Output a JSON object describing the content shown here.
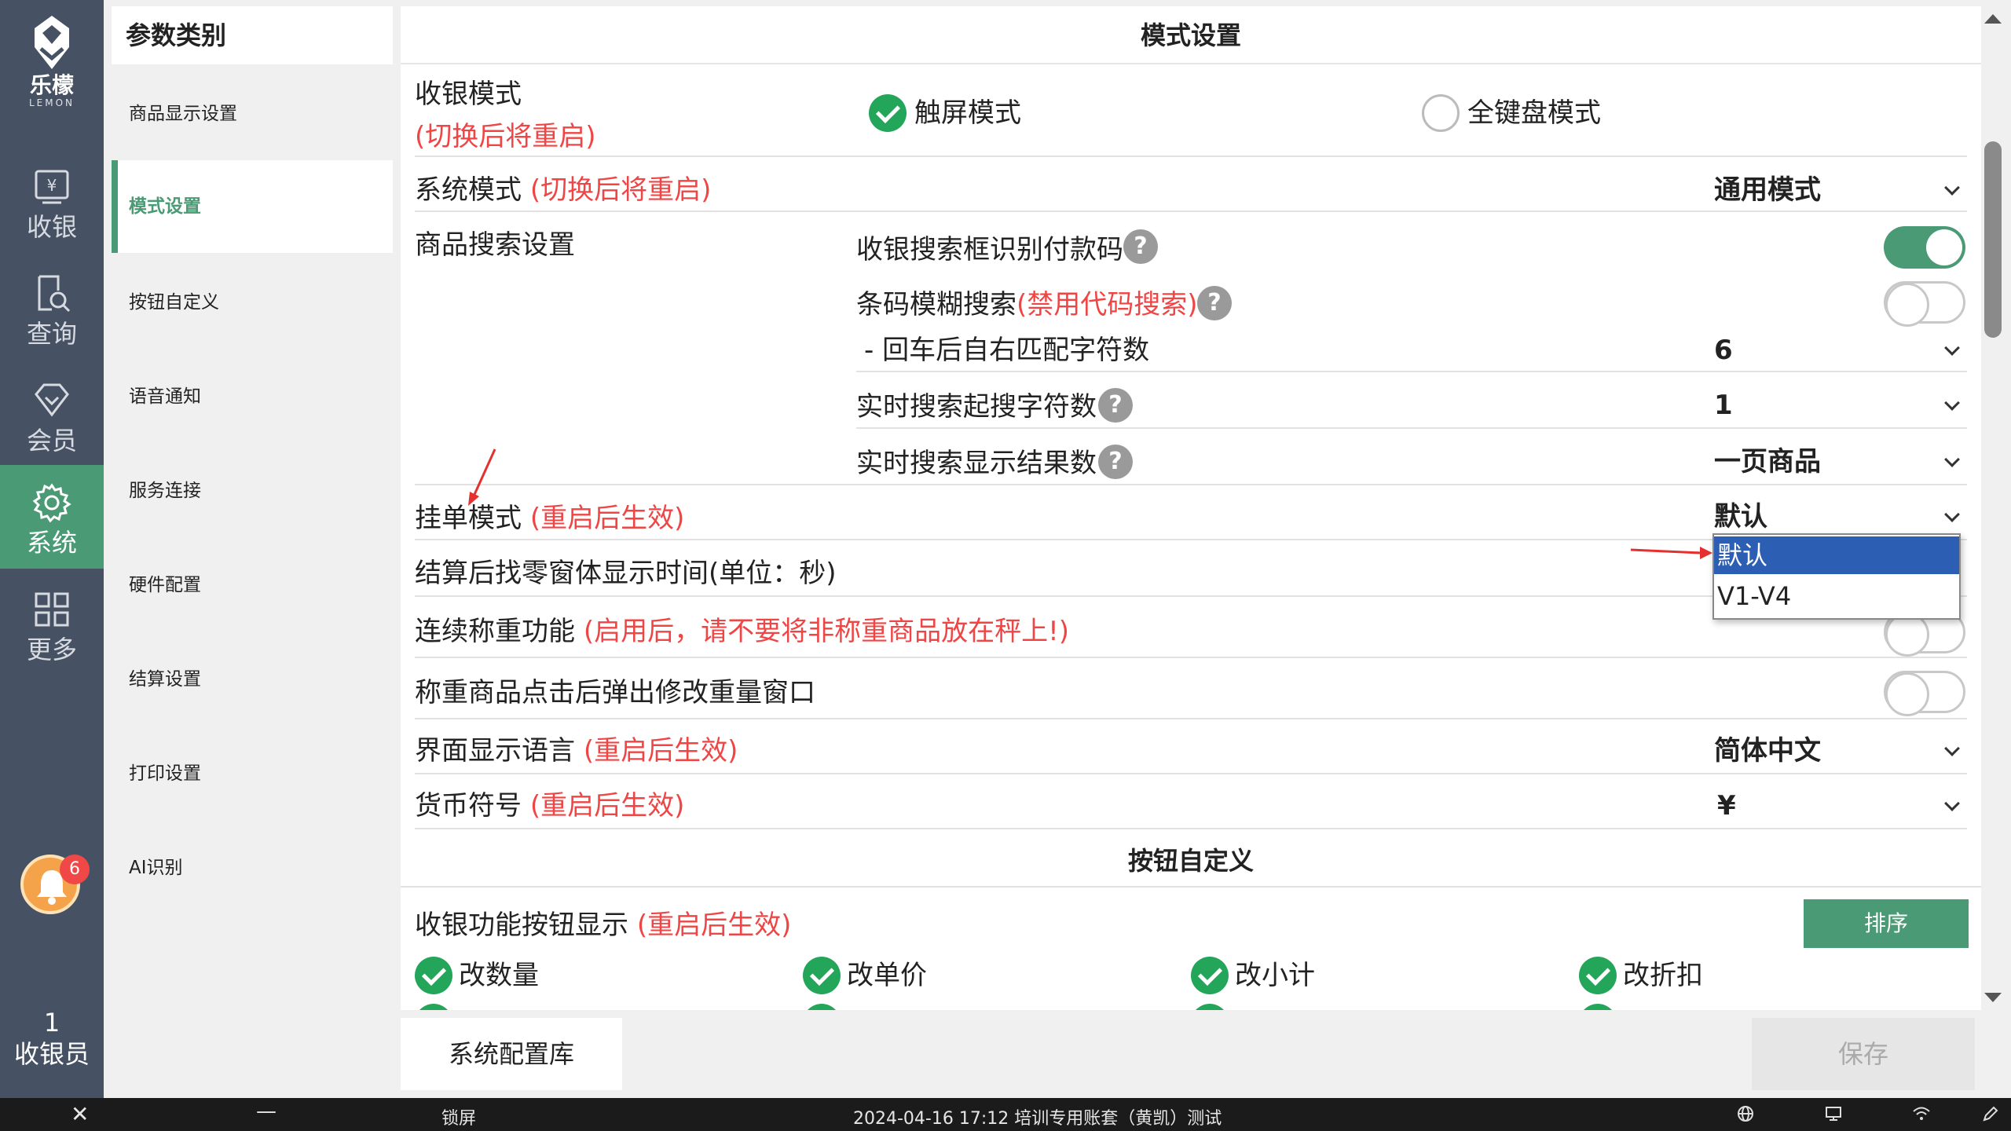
{
  "brand": {
    "name_cn": "乐檬",
    "name_en": "LEMON"
  },
  "rail": {
    "items": [
      {
        "label": "收银",
        "icon": "cash-register-icon"
      },
      {
        "label": "查询",
        "icon": "search-doc-icon"
      },
      {
        "label": "会员",
        "icon": "diamond-icon"
      },
      {
        "label": "系统",
        "icon": "gear-icon"
      },
      {
        "label": "更多",
        "icon": "grid-icon"
      }
    ],
    "notification_count": "6",
    "user_line1": "1",
    "user_line2": "收银员"
  },
  "categories": {
    "header": "参数类别",
    "items": [
      {
        "label": "商品显示设置"
      },
      {
        "label": "模式设置"
      },
      {
        "label": "按钮自定义"
      },
      {
        "label": "语音通知"
      },
      {
        "label": "服务连接"
      },
      {
        "label": "硬件配置"
      },
      {
        "label": "结算设置"
      },
      {
        "label": "打印设置"
      },
      {
        "label": "AI识别"
      }
    ],
    "active": "模式设置"
  },
  "main": {
    "title": "模式设置",
    "cash_mode": {
      "label": "收银模式",
      "note": "(切换后将重启)",
      "option_touch": "触屏模式",
      "option_keyboard": "全键盘模式",
      "selected": "触屏模式"
    },
    "system_mode": {
      "label": "系统模式",
      "note": "(切换后将重启)",
      "value": "通用模式"
    },
    "search_settings": {
      "label": "商品搜索设置",
      "recognize_pay_code": {
        "label": "收银搜索框识别付款码",
        "on": true
      },
      "fuzzy_barcode": {
        "label": "条码模糊搜索",
        "note": "(禁用代码搜索)",
        "on": false
      },
      "enter_match": {
        "label": "- 回车后自右匹配字符数",
        "value": "6"
      },
      "realtime_min": {
        "label": "实时搜索起搜字符数",
        "value": "1"
      },
      "realtime_results": {
        "label": "实时搜索显示结果数",
        "value": "一页商品"
      }
    },
    "hold_mode": {
      "label": "挂单模式",
      "note": "(重启后生效)",
      "value": "默认",
      "options": [
        "默认",
        "V1-V4"
      ]
    },
    "change_window": {
      "label": "结算后找零窗体显示时间(单位：秒)"
    },
    "continuous_weigh": {
      "label": "连续称重功能",
      "note": "(启用后，请不要将非称重商品放在秤上!)",
      "on": false
    },
    "weigh_popup": {
      "label": "称重商品点击后弹出修改重量窗口",
      "on": false
    },
    "language": {
      "label": "界面显示语言",
      "note": "(重启后生效)",
      "value": "简体中文"
    },
    "currency": {
      "label": "货币符号",
      "note": "(重启后生效)",
      "value": "¥"
    },
    "button_section_title": "按钮自定义",
    "button_display": {
      "label": "收银功能按钮显示",
      "note": "(重启后生效)",
      "sort_label": "排序"
    },
    "buttons": [
      "改数量",
      "改单价",
      "改小计",
      "改折扣"
    ]
  },
  "footer": {
    "config_lib": "系统配置库",
    "save": "保存"
  },
  "taskbar": {
    "lock": "锁屏",
    "info": "2024-04-16 17:12 培训专用账套（黄凯）测试"
  },
  "colors": {
    "accent": "#4a9a75",
    "rail": "#465264",
    "warn": "#f04545",
    "selected": "#2c5fb3"
  }
}
